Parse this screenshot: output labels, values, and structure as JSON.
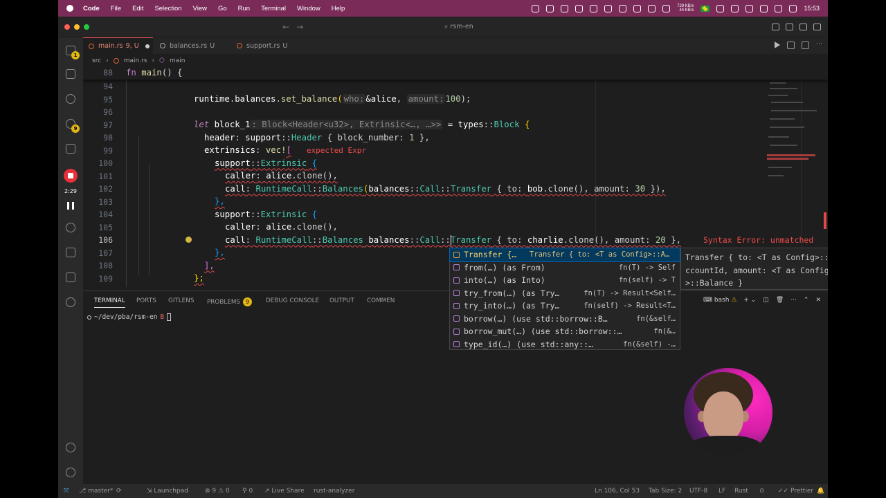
{
  "menubar": {
    "app": "Code",
    "items": [
      "File",
      "Edit",
      "Selection",
      "View",
      "Go",
      "Run",
      "Terminal",
      "Window",
      "Help"
    ],
    "net_up": "729 KB/s",
    "net_down": "44 KB/s",
    "time": "15:53"
  },
  "titlebar": {
    "search": "rsm-en"
  },
  "recording": {
    "time": "2:29"
  },
  "activity_badges": {
    "explorer": "1",
    "scm": "9"
  },
  "tabs": [
    {
      "name": "main.rs",
      "status": "9, U"
    },
    {
      "name": "balances.rs",
      "status": "U"
    },
    {
      "name": "support.rs",
      "status": "U"
    }
  ],
  "breadcrumb": {
    "folder": "src",
    "file": "main.rs",
    "symbol": "main"
  },
  "editor": {
    "sticky_line": "88",
    "sticky_code": "fn main() {",
    "line_numbers": [
      "94",
      "95",
      "96",
      "97",
      "98",
      "99",
      "100",
      "101",
      "102",
      "103",
      "104",
      "105",
      "106",
      "107",
      "108",
      "109"
    ],
    "lines": {
      "l95": {
        "a": "runtime",
        "b": ".",
        "c": "balances",
        "d": ".",
        "e": "set_balance",
        "f": "(",
        "g": "who:",
        "h": "&alice",
        "i": ", ",
        "j": "amount:",
        "k": "100",
        "l": ");"
      },
      "l97": {
        "kw": "let",
        "name": "block_1",
        "hint": ": Block<Header<u32>, Extrinsic<…, …>>",
        "eq": " = ",
        "path": "types",
        "sep": "::",
        "ty": "Block",
        "brace": " {"
      },
      "l98": {
        "field": "header",
        "colon": ": ",
        "mod": "support",
        "sep": "::",
        "ty": "Header",
        "rest": " { block_number: ",
        "num": "1",
        "end": " },"
      },
      "l99": {
        "field": "extrinsics",
        "colon": ": ",
        "mac": "vec!",
        "br": "[",
        "err": "expected Expr"
      },
      "l100": {
        "mod": "support",
        "sep": "::",
        "ty": "Extrinsic",
        "brace": " {"
      },
      "l101": {
        "field": "caller",
        "colon": ": ",
        "var": "alice",
        "rest": ".clone(),"
      },
      "l102": {
        "field": "call",
        "colon": ": ",
        "ty1": "RuntimeCall",
        "sep1": "::",
        "ty2": "Balances",
        "p": "(",
        "mod": "balances",
        "sep2": "::",
        "ty3": "Call",
        "sep3": "::",
        "ty4": "Transfer",
        "rest1": " { to: ",
        "var": "bob",
        "rest2": ".clone(), amount: ",
        "num": "30",
        "end": " }),"
      },
      "l103": {
        "code": "},"
      },
      "l104": {
        "mod": "support",
        "sep": "::",
        "ty": "Extrinsic",
        "brace": " {"
      },
      "l105": {
        "field": "caller",
        "colon": ": ",
        "var": "alice",
        "rest": ".clone(),"
      },
      "l106": {
        "field": "call",
        "colon": ": ",
        "ty1": "RuntimeCall",
        "sep1": "::",
        "ty2": "Balances",
        "sp": " ",
        "mod": "balances",
        "sep2": "::",
        "ty3": "Call",
        "sep3": "::",
        "ty4": "Transfer",
        "rest1": " { to: ",
        "var": "charlie",
        "rest2": ".clone(), amount: ",
        "num": "20",
        "end": " },",
        "err": "Syntax Error: unmatched"
      },
      "l107": {
        "code": "},"
      },
      "l108": {
        "code": "],"
      },
      "l109": {
        "code": "};"
      }
    }
  },
  "suggest": {
    "items": [
      {
        "label": "Transfer {…",
        "detail": "Transfer { to: <T as Config>::A…"
      },
      {
        "label": "from(…) (as From)",
        "detail": "fn(T) -> Self"
      },
      {
        "label": "into(…) (as Into)",
        "detail": "fn(self) -> T"
      },
      {
        "label": "try_from(…) (as Try…",
        "detail": "fn(T) -> Result<Self…"
      },
      {
        "label": "try_into(…) (as Try…",
        "detail": "fn(self) -> Result<T…"
      },
      {
        "label": "borrow(…) (use std::borrow::B…",
        "detail": "fn(&self…"
      },
      {
        "label": "borrow_mut(…) (use std::borrow::…",
        "detail": "fn(&…"
      },
      {
        "label": "type_id(…) (use std::any::…",
        "detail": "fn(&self) -…"
      }
    ],
    "details": [
      "Transfer { to: <T as Config>::A",
      "ccountId, amount: <T as Config",
      ">::Balance }"
    ]
  },
  "panel": {
    "tabs": [
      "TERMINAL",
      "PORTS",
      "GITLENS",
      "PROBLEMS",
      "DEBUG CONSOLE",
      "OUTPUT",
      "COMMEN"
    ],
    "problems_count": "9",
    "prompt": "~/dev/pba/rsm-en",
    "prompt_suffix": "B",
    "shell": "bash"
  },
  "statusbar": {
    "branch": "master*",
    "launchpad": "Launchpad",
    "errors": "9",
    "warnings": "0",
    "ports": "0",
    "liveshare": "Live Share",
    "analyzer": "rust-analyzer",
    "position": "Ln 106, Col 53",
    "tabsize": "Tab Size: 2",
    "encoding": "UTF-8",
    "eol": "LF",
    "language": "Rust",
    "formatter": "Prettier"
  },
  "colors": {
    "menubar": "#7a2b58",
    "accent_error": "#f14c4c",
    "badge": "#e2b714",
    "record": "#e8303a"
  }
}
